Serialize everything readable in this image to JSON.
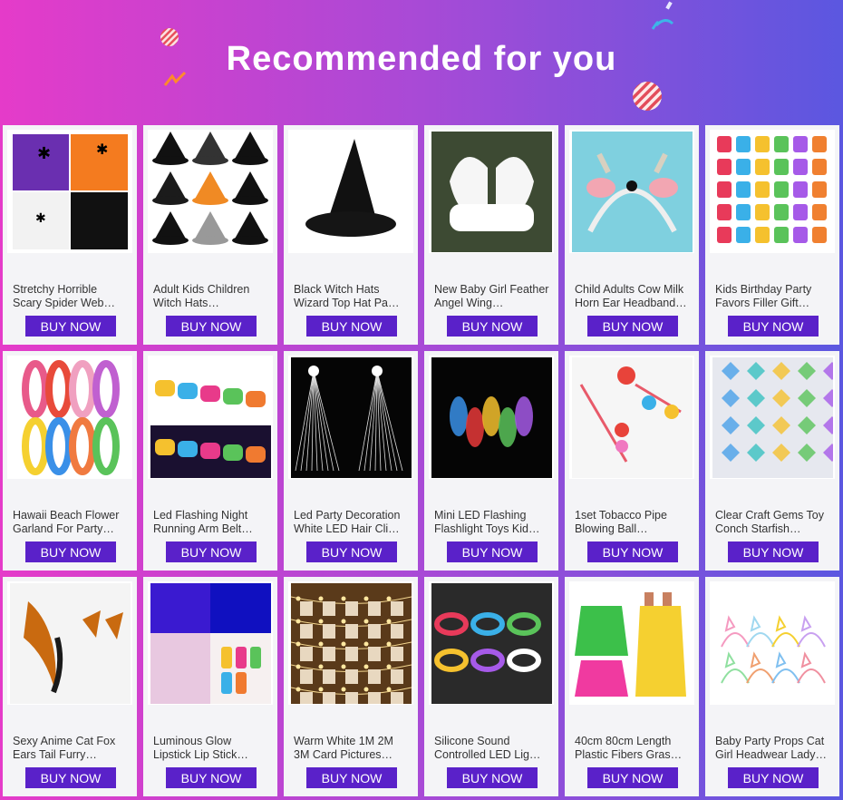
{
  "header": {
    "title": "Recommended for you"
  },
  "products": [
    {
      "name": "Stretchy Horrible Scary Spider Web…",
      "button": "BUY NOW",
      "icon": "spider-web-icon"
    },
    {
      "name": "Adult Kids Children Witch Hats…",
      "button": "BUY NOW",
      "icon": "witch-hats-icon"
    },
    {
      "name": "Black Witch Hats Wizard Top Hat Pa…",
      "button": "BUY NOW",
      "icon": "witch-hat-icon"
    },
    {
      "name": "New Baby Girl Feather Angel Wing…",
      "button": "BUY NOW",
      "icon": "angel-wing-icon"
    },
    {
      "name": "Child Adults Cow Milk Horn Ear Headband…",
      "button": "BUY NOW",
      "icon": "cow-headband-icon"
    },
    {
      "name": "Kids Birthday Party Favors Filler Gift…",
      "button": "BUY NOW",
      "icon": "party-favors-icon"
    },
    {
      "name": "Hawaii Beach Flower Garland For Party…",
      "button": "BUY NOW",
      "icon": "flower-garland-icon"
    },
    {
      "name": "Led Flashing Night Running Arm Belt…",
      "button": "BUY NOW",
      "icon": "led-armband-icon"
    },
    {
      "name": "Led Party Decoration White LED Hair Cli…",
      "button": "BUY NOW",
      "icon": "fiber-hair-clip-icon"
    },
    {
      "name": "Mini LED Flashing Flashlight Toys Kid…",
      "button": "BUY NOW",
      "icon": "led-bracelet-icon"
    },
    {
      "name": "1set Tobacco Pipe Blowing Ball…",
      "button": "BUY NOW",
      "icon": "blowing-ball-icon"
    },
    {
      "name": "Clear Craft Gems Toy Conch Starfish…",
      "button": "BUY NOW",
      "icon": "craft-gems-icon"
    },
    {
      "name": "Sexy Anime Cat Fox Ears Tail Furry…",
      "button": "BUY NOW",
      "icon": "fox-tail-icon"
    },
    {
      "name": "Luminous Glow Lipstick Lip Stick…",
      "button": "BUY NOW",
      "icon": "glow-lipstick-icon"
    },
    {
      "name": "Warm White 1M 2M 3M Card Pictures…",
      "button": "BUY NOW",
      "icon": "photo-string-lights-icon"
    },
    {
      "name": "Silicone Sound Controlled LED Lig…",
      "button": "BUY NOW",
      "icon": "led-wristband-icon"
    },
    {
      "name": "40cm 80cm Length Plastic Fibers Gras…",
      "button": "BUY NOW",
      "icon": "grass-skirt-icon"
    },
    {
      "name": "Baby Party Props Cat Girl Headwear Lady…",
      "button": "BUY NOW",
      "icon": "cat-ear-headband-icon"
    }
  ],
  "colors": {
    "button": "#5a21c9",
    "card": "#f4f4f7",
    "gradient_left": "#e53bc9",
    "gradient_right": "#5b57e0"
  }
}
